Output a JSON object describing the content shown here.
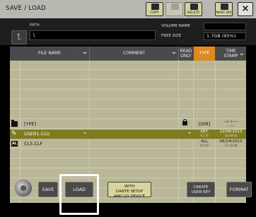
{
  "window": {
    "title": "SAVE / LOAD",
    "toolbar": [
      {
        "name": "copy-button",
        "label": "COPY",
        "enabled": true
      },
      {
        "name": "paste-button",
        "label": "",
        "enabled": false
      },
      {
        "name": "delete-button",
        "label": "DELETE",
        "enabled": true
      },
      {
        "name": "make-dir-button",
        "label": "MAKE DIR",
        "enabled": true
      }
    ],
    "close_label": "×"
  },
  "path_bar": {
    "up_label": "⮤",
    "path_label": "PATH",
    "path_value": "\\",
    "volume_name_label": "VOLUME NAME",
    "volume_name_value": "",
    "free_size_label": "FREE SIZE",
    "free_size_value": "1.7GB (95%)"
  },
  "table": {
    "headers": {
      "file_name": "FILE NAME",
      "comment": "COMMENT",
      "read_only_1": "READ",
      "read_only_2": "ONLY",
      "type": "TYPE",
      "time_stamp_1": "TIME",
      "time_stamp_2": "STAMP"
    },
    "rows": [
      {
        "icon": "",
        "name": "",
        "comment": "",
        "read_only": false,
        "type_1": "",
        "type_2": "",
        "time_1": "",
        "time_2": "",
        "selected": false
      },
      {
        "icon": "",
        "name": "",
        "comment": "",
        "read_only": false,
        "type_1": "",
        "type_2": "",
        "time_1": "",
        "time_2": "",
        "selected": false
      },
      {
        "icon": "",
        "name": "",
        "comment": "",
        "read_only": false,
        "type_1": "",
        "type_2": "",
        "time_1": "",
        "time_2": "",
        "selected": false
      },
      {
        "icon": "",
        "name": "",
        "comment": "",
        "read_only": false,
        "type_1": "",
        "type_2": "",
        "time_1": "",
        "time_2": "",
        "selected": false
      },
      {
        "icon": "",
        "name": "",
        "comment": "",
        "read_only": false,
        "type_1": "",
        "type_2": "",
        "time_1": "",
        "time_2": "",
        "selected": false
      },
      {
        "icon": "",
        "name": "",
        "comment": "",
        "read_only": false,
        "type_1": "",
        "type_2": "",
        "time_1": "",
        "time_2": "",
        "selected": false
      },
      {
        "icon": "folder-icon",
        "name": "[YPE]",
        "comment": "",
        "read_only": true,
        "type_1": "[DIR]",
        "type_2": "",
        "time_1": "--/--/----",
        "time_2": "--:--:--",
        "selected": false
      },
      {
        "icon": "usb-icon",
        "name": "USER1.CLU",
        "comment": "",
        "read_only": false,
        "type_1": "KEY",
        "type_2": "V1.70",
        "time_1": "12/06/2013",
        "time_2": "18:08:44",
        "selected": true
      },
      {
        "icon": "file-icon",
        "icon_text": "AL",
        "name": "CL5.CLF",
        "comment": "",
        "read_only": false,
        "type_1": "ALL",
        "type_2": "V1.50",
        "time_1": "06/24/2013",
        "time_2": "17:15:48",
        "selected": false
      },
      {
        "icon": "",
        "name": "",
        "comment": "",
        "read_only": false,
        "type_1": "",
        "type_2": "",
        "time_1": "",
        "time_2": "",
        "selected": false
      },
      {
        "icon": "",
        "name": "",
        "comment": "",
        "read_only": false,
        "type_1": "",
        "type_2": "",
        "time_1": "",
        "time_2": "",
        "selected": false
      },
      {
        "icon": "",
        "name": "",
        "comment": "",
        "read_only": false,
        "type_1": "",
        "type_2": "",
        "time_1": "",
        "time_2": "",
        "selected": false
      },
      {
        "icon": "",
        "name": "",
        "comment": "",
        "read_only": false,
        "type_1": "",
        "type_2": "",
        "time_1": "",
        "time_2": "",
        "selected": false
      },
      {
        "icon": "",
        "name": "",
        "comment": "",
        "read_only": false,
        "type_1": "",
        "type_2": "",
        "time_1": "",
        "time_2": "",
        "selected": false
      }
    ]
  },
  "bottom": {
    "save_label": "SAVE",
    "load_label": "LOAD",
    "dante_label_1": "WITH",
    "dante_label_2": "DANTE SETUP",
    "dante_label_3": "AND I/O DEVICE",
    "create_key_1": "CREATE",
    "create_key_2": "USER KEY",
    "format_label": "FORMAT"
  },
  "colors": {
    "accent_orange": "#e08a1e",
    "selected_row": "#7e7c1e",
    "list_background": "#b9b797"
  }
}
